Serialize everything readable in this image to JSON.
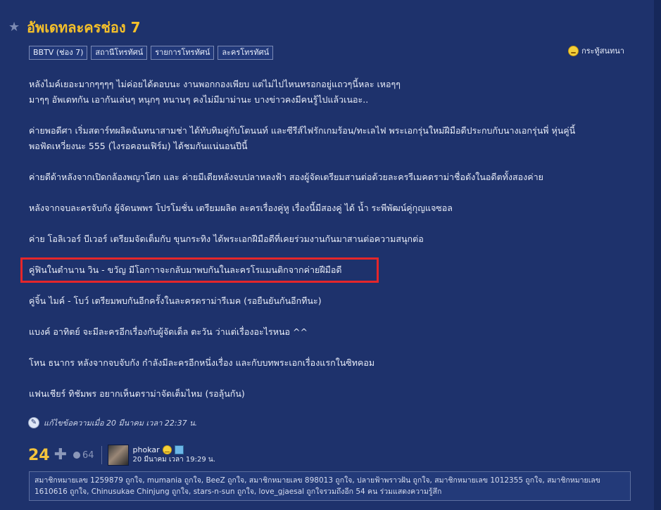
{
  "topic": {
    "title": "อัพเดทละครช่อง 7",
    "tags": [
      "BBTV (ช่อง 7)",
      "สถานีโทรทัศน์",
      "รายการโทรทัศน์",
      "ละครโทรทัศน์"
    ],
    "emotion_label": "กระทู้สนทนา"
  },
  "post": {
    "paragraphs": [
      [
        "หลังไมค์เยอะมากๆๆๆๆ ไม่ค่อยได้ตอบนะ งานพอกกองเพียบ แต่ไม่ไปไหนหรอกอยู่แถวๆนี้หละ เหอๆๆ",
        "มาๆๆ อัพเดทกัน เอากันเล่นๆ หนุกๆ หนานๆ คงไม่มีมาม่านะ บางข่าวคงมีคนรู้ไปแล้วเนอะ.."
      ],
      [
        "ค่ายพอดีศา เริ่มสตาร์ทผลิตฉันทนาสามช่า ได้ทับทิมคู่กับโตนนท์ และซีรีส์ไฟรักเกมร้อน/ทะเลไฟ พระเอกรุ่นใหม่ฝีมือดีประกบกับนางเอกรุ่นพี่ หุ่นคู่นี้",
        "พอฟัดเหวี่ยงนะ 555 (ไงรอคอนเฟิร์ม) ได้ชมกันแน่นอนปีนี้"
      ],
      [
        "ค่ายดีด้าหลังจากเปิดกล้องพญาโศก และ ค่ายมีเดียหลังจบปลาหลงฟ้า สองผู้จัดเตรียมสานต่อด้วยละครรีเมคดราม่าชื่อดังในอดีตทั้งสองค่าย"
      ],
      [
        "หลังจากจบละครจับกัง ผู้จัดนพพร โปรโมชั่น เตรียมผลิต ละครเรื่องคู่หู  เรื่องนี้มีสองคู่ ได้ น้ำ ระพีพัฒน์คู่กุญแจซอล"
      ],
      [
        "ค่าย โอลิเวอร์ บีเวอร์ เตรียมจัดเต็มกับ ขุนกระทิง ได้พระเอกฝีมือดีที่เคยร่วมงานกันมาสานต่อความสนุกต่อ"
      ],
      [
        "คู่ฟินในตำนาน วิน - ขวัญ มีโอกาาจะกลับมาพบกันในละครโรแมนติกจากค่ายฝีมือดี"
      ],
      [
        "คู่จิ้น ไมค์ - โบว์ เตรียมพบกันอีกครั้งในละครดราม่ารีเมค (รอยืนยันกันอีกทีนะ)"
      ],
      [
        "แบงค์ อาทิตย์ จะมีละครอีกเรื่องกับผู้จัดเต็ล ตะวัน ว่าแต่เรื่องอะไรหนอ ^^"
      ],
      [
        "โหน ธนากร หลังจากจบจับกัง กำลังมีละครอีกหนึ่งเรื่อง และกับบทพระเอกเรื่องแรกในซิทคอม"
      ],
      [
        "แฟนเชียร์ ทิชัมพร อยากเห็นดราม่าจัดเต็มไหม (รอลุ้นกัน)"
      ]
    ],
    "edited_note": "แก้ไขข้อความเมื่อ 20 มีนาคม เวลา 22:37 น."
  },
  "footer": {
    "score": "24",
    "emotion_count": "64",
    "username": "phokar",
    "timestamp": "20 มีนาคม เวลา 19:29 น.",
    "likes_text": "สมาชิกหมายเลข 1259879 ถูกใจ, mumania ถูกใจ, BeeZ ถูกใจ, สมาชิกหมายเลข 898013 ถูกใจ, ปลายฟ้าพราวฝัน ถูกใจ, สมาชิกหมายเลข 1012355 ถูกใจ, สมาชิกหมายเลข 1610616 ถูกใจ, Chinusukae Chinjung ถูกใจ, stars-n-sun ถูกใจ, love_gjaesal ถูกใจรวมถึงอีก 54 คน ร่วมแสดงความรู้สึก"
  },
  "colors": {
    "background": "#1e326c",
    "title": "#f5c02a",
    "highlight_box": "#e5262a"
  },
  "icons": {
    "favorite": "star-icon",
    "emotion": "smile-icon",
    "edit": "edit-icon",
    "plus": "plus-icon",
    "badge": "member-badge-icon"
  }
}
